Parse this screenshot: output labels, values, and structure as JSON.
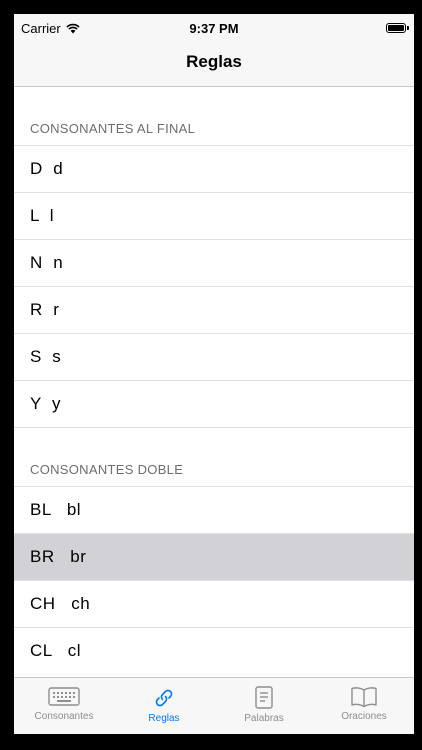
{
  "status_bar": {
    "carrier": "Carrier",
    "time": "9:37 PM"
  },
  "nav": {
    "title": "Reglas"
  },
  "sections": [
    {
      "header": "CONSONANTES AL FINAL",
      "rows": [
        "D  d",
        "L  l",
        "N  n",
        "R  r",
        "S  s",
        "Y  y"
      ]
    },
    {
      "header": "CONSONANTES DOBLE",
      "rows": [
        "BL   bl",
        "BR   br",
        "CH   ch",
        "CL   cl"
      ]
    }
  ],
  "tabs": [
    {
      "label": "Consonantes",
      "icon": "keyboard-icon"
    },
    {
      "label": "Reglas",
      "icon": "link-icon"
    },
    {
      "label": "Palabras",
      "icon": "document-icon"
    },
    {
      "label": "Oraciones",
      "icon": "book-icon"
    }
  ],
  "colors": {
    "accent": "#007aff",
    "tab_inactive": "#8e8e93",
    "selected_row": "#d1d1d6",
    "section_header_text": "#6d6d72"
  }
}
